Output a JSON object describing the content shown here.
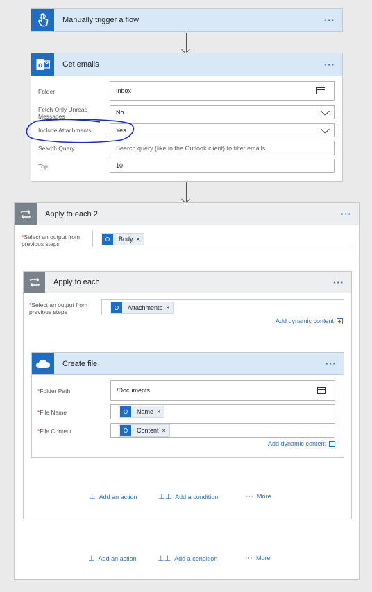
{
  "trigger": {
    "title": "Manually trigger a flow",
    "menu": "···"
  },
  "get_emails": {
    "title": "Get emails",
    "menu": "···",
    "folder_label": "Folder",
    "folder_value": "Inbox",
    "unread_label": "Fetch Only Unread Messages",
    "unread_value": "No",
    "attach_label": "Include Attachments",
    "attach_value": "Yes",
    "search_label": "Search Query",
    "search_placeholder": "Search query (like in the Outlook client) to filter emails.",
    "top_label": "Top",
    "top_value": "10"
  },
  "apply_each_2": {
    "title": "Apply to each 2",
    "menu": "···",
    "select_label": "Select an output from previous steps",
    "token": "Body"
  },
  "apply_each": {
    "title": "Apply to each",
    "menu": "···",
    "select_label": "Select an output from previous steps",
    "token": "Attachments",
    "dynamic": "Add dynamic content"
  },
  "create_file": {
    "title": "Create file",
    "menu": "···",
    "path_label": "Folder Path",
    "path_value": "/Documents",
    "name_label": "File Name",
    "name_token": "Name",
    "content_label": "File Content",
    "content_token": "Content",
    "dynamic": "Add dynamic content"
  },
  "actions_inner": {
    "add_action": "Add an action",
    "add_condition": "Add a condition",
    "more": "More"
  },
  "actions_outer": {
    "add_action": "Add an action",
    "add_condition": "Add a condition",
    "more": "More"
  },
  "colors": {
    "accent": "#2a6fba",
    "header_blue": "#d8e8f7",
    "loop_gray": "#7a838c",
    "annotation": "#1c2fb5"
  }
}
